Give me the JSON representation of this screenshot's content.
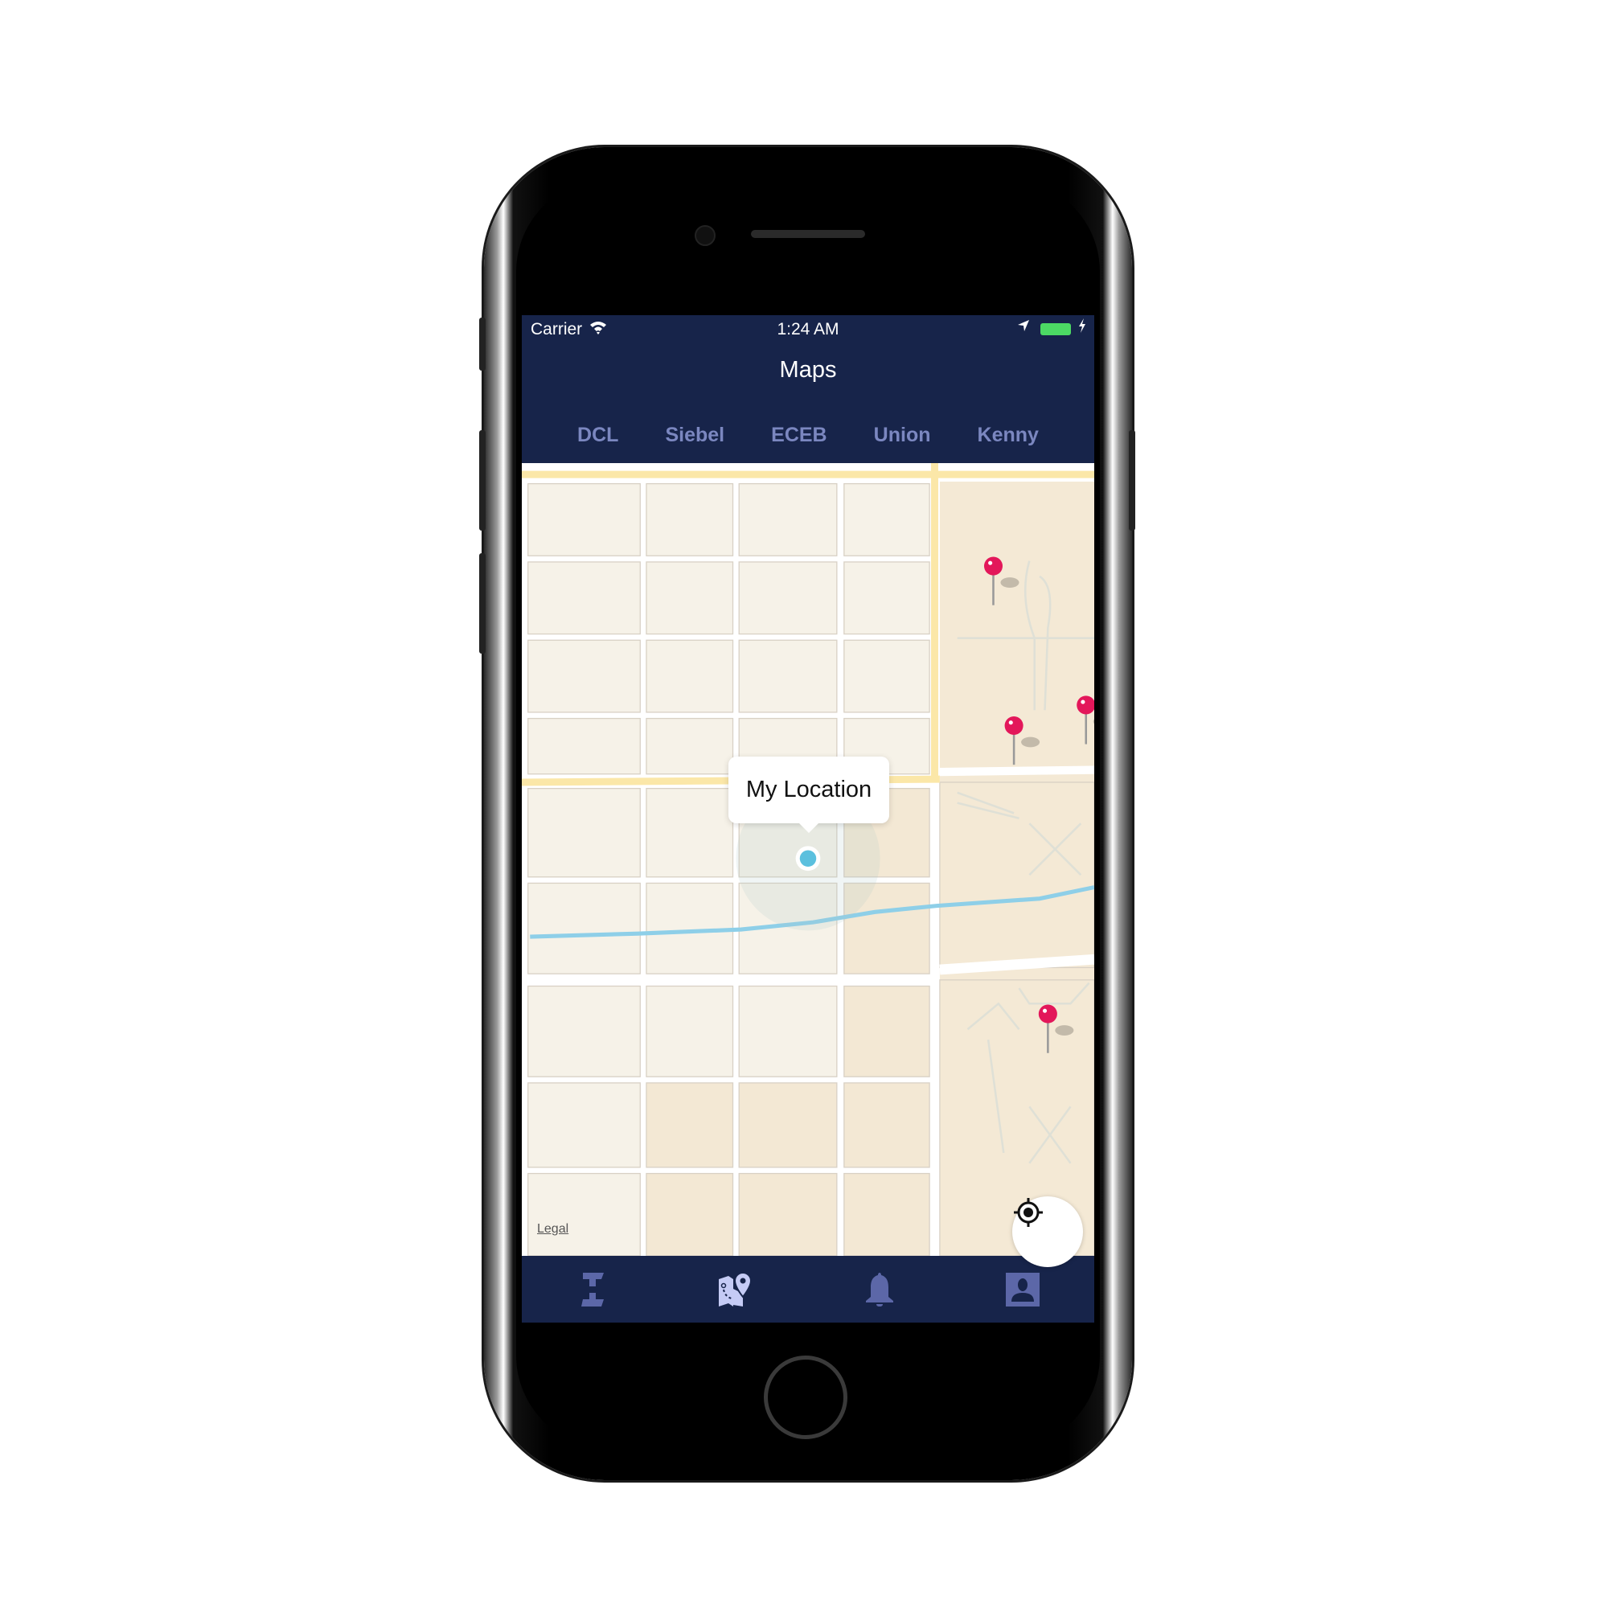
{
  "status_bar": {
    "carrier": "Carrier",
    "time": "1:24 AM",
    "battery_color": "#4cd964"
  },
  "nav": {
    "title": "Maps"
  },
  "building_tabs": [
    {
      "label": "DCL"
    },
    {
      "label": "Siebel"
    },
    {
      "label": "ECEB"
    },
    {
      "label": "Union"
    },
    {
      "label": "Kenny"
    }
  ],
  "map": {
    "callout": "My Location",
    "legal": "Legal",
    "pin_color": "#e3175a",
    "user_dot_color": "#5bc0de",
    "locate_icon": "crosshair-icon"
  },
  "tab_bar": {
    "items": [
      {
        "icon": "schedule-icon",
        "active": false
      },
      {
        "icon": "map-icon",
        "active": true
      },
      {
        "icon": "bell-icon",
        "active": false
      },
      {
        "icon": "profile-icon",
        "active": false
      }
    ],
    "active_color": "#c5cbf5",
    "inactive_color": "#5c67a8"
  },
  "colors": {
    "header_bg": "#17244a",
    "tab_text": "#7b87c0"
  }
}
